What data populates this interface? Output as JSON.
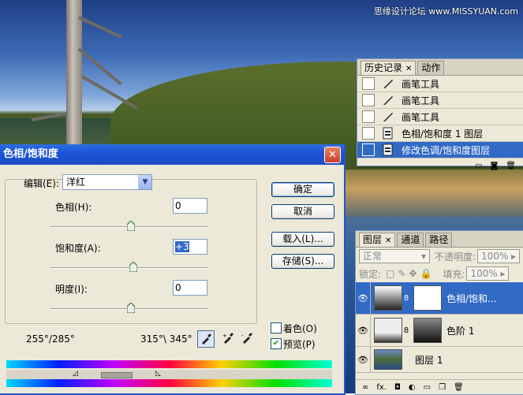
{
  "watermark": "思缘设计论坛 www.MISSYUAN.com",
  "history_panel": {
    "tabs": [
      {
        "label": "历史记录"
      },
      {
        "label": "动作"
      }
    ],
    "items": [
      {
        "label": "画笔工具",
        "icon": "brush-icon"
      },
      {
        "label": "画笔工具",
        "icon": "brush-icon"
      },
      {
        "label": "画笔工具",
        "icon": "brush-icon"
      },
      {
        "label": "色相/饱和度 1 图层",
        "icon": "history-state-icon"
      },
      {
        "label": "修改色调/饱和度图层",
        "icon": "history-state-icon",
        "selected": true
      }
    ]
  },
  "layers_panel": {
    "tabs": [
      {
        "label": "图层"
      },
      {
        "label": "通道"
      },
      {
        "label": "路径"
      }
    ],
    "blend_mode": "正常",
    "opacity_label": "不透明度:",
    "opacity_value": "100%",
    "lock_label": "锁定:",
    "fill_label": "填充:",
    "fill_value": "100%",
    "layers": [
      {
        "name": "色相/饱和...",
        "selected": true
      },
      {
        "name": "色阶 1",
        "selected": false
      },
      {
        "name": "图层 1",
        "selected": false
      }
    ],
    "footer": {
      "fx": "fx."
    }
  },
  "dialog": {
    "title": "色相/饱和度",
    "edit_label": "编辑(E):",
    "edit_value": "洋红",
    "hue_label": "色相(H):",
    "hue_value": "0",
    "saturation_label": "饱和度(A):",
    "saturation_value": "+3",
    "lightness_label": "明度(I):",
    "lightness_value": "0",
    "range_left": "255°/285°",
    "range_right": "315°\\ 345°",
    "buttons": {
      "ok": "确定",
      "cancel": "取消",
      "load": "载入(L)...",
      "save": "存储(S)..."
    },
    "colorize_label": "着色(O)",
    "colorize_checked": false,
    "preview_label": "预览(P)",
    "preview_checked": true
  }
}
